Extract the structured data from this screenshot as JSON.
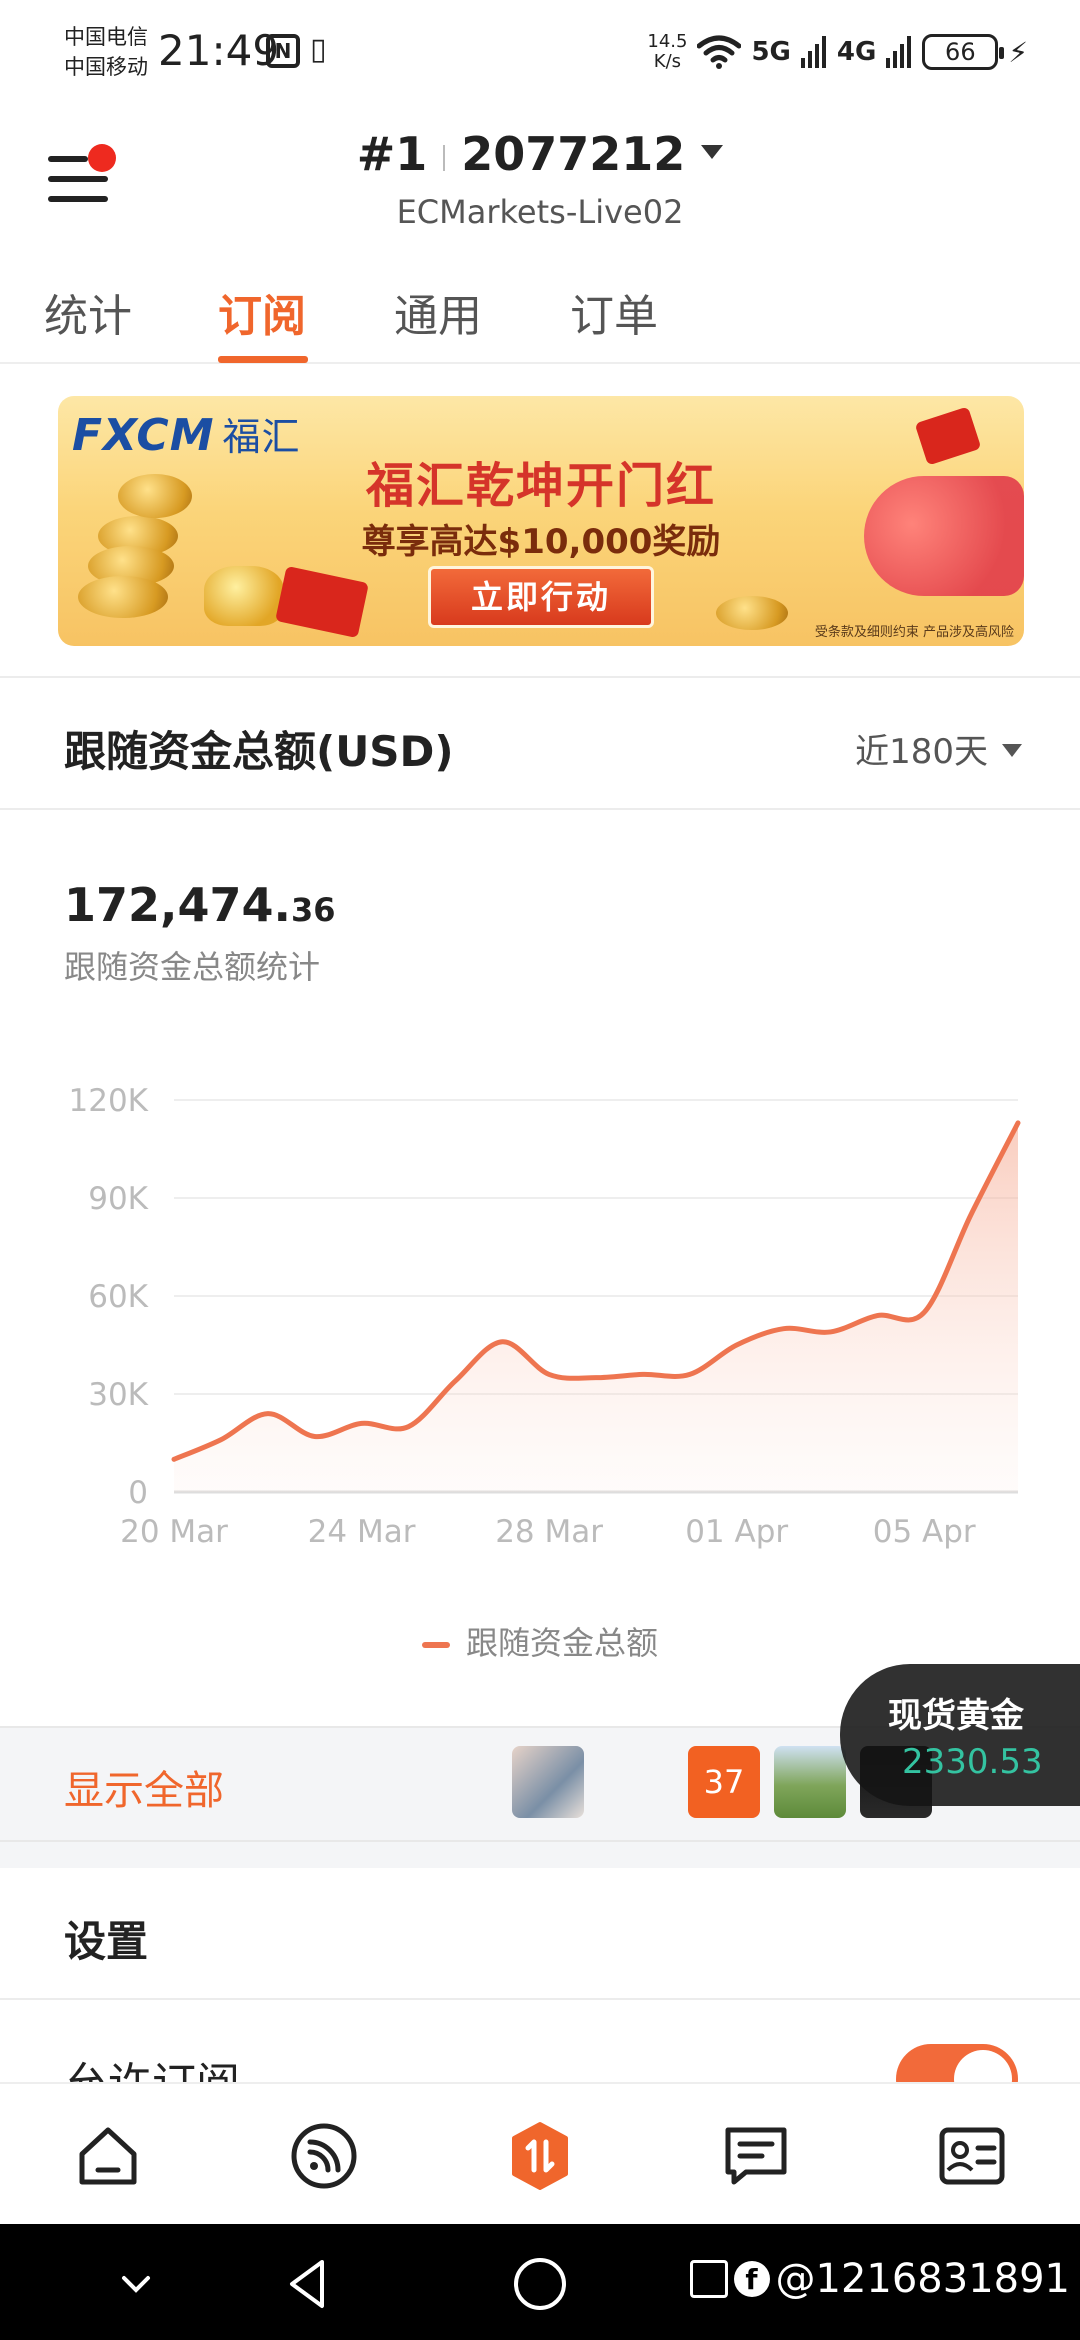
{
  "status_bar": {
    "carrier_1": "中国电信",
    "carrier_2": "中国移动",
    "time": "21:49",
    "nfc_icon": "N",
    "net_speed": "14.5",
    "net_speed_unit": "K/s",
    "signal_1": "5G",
    "signal_2": "4G",
    "battery": "66"
  },
  "header": {
    "account_rank": "#1",
    "account_id": "2077212",
    "server": "ECMarkets-Live02"
  },
  "tabs": [
    {
      "label": "统计",
      "active": false
    },
    {
      "label": "订阅",
      "active": true
    },
    {
      "label": "通用",
      "active": false
    },
    {
      "label": "订单",
      "active": false
    }
  ],
  "banner": {
    "brand": "FXCM",
    "brand_zh": "福汇",
    "title": "福汇乾坤开门红",
    "subtitle": "尊享高达$10,000奖励",
    "cta": "立即行动",
    "disclaimer": "受条款及细则约束 产品涉及高风险",
    "colors": {
      "accent": "#d5342a",
      "background": "#fbd57a"
    }
  },
  "card": {
    "title": "跟随资金总额(USD)",
    "range": "近180天",
    "total_int": "172,474.",
    "total_dec": "36",
    "total_label": "跟随资金总额统计",
    "legend": "跟随资金总额"
  },
  "chart_data": {
    "type": "area",
    "x": [
      "20 Mar",
      "21 Mar",
      "22 Mar",
      "23 Mar",
      "24 Mar",
      "25 Mar",
      "26 Mar",
      "27 Mar",
      "28 Mar",
      "29 Mar",
      "30 Mar",
      "31 Mar",
      "01 Apr",
      "02 Apr",
      "03 Apr",
      "04 Apr",
      "05 Apr",
      "06 Apr",
      "07 Apr"
    ],
    "series": [
      {
        "name": "跟随资金总额",
        "values": [
          10000,
          16000,
          24000,
          17000,
          21000,
          20000,
          34000,
          46000,
          36000,
          35000,
          36000,
          36000,
          45000,
          50000,
          49000,
          54000,
          55000,
          85000,
          113000
        ]
      }
    ],
    "x_tick_labels": [
      "20 Mar",
      "24 Mar",
      "28 Mar",
      "01 Apr",
      "05 Apr"
    ],
    "y_tick_labels": [
      "0",
      "30K",
      "60K",
      "90K",
      "120K"
    ],
    "ylim": [
      0,
      120000
    ],
    "grid": true,
    "color": "#ee7550"
  },
  "show_all": {
    "label": "显示全部",
    "badge_count": "37"
  },
  "ticker": {
    "name": "现货黄金",
    "price": "2330.53"
  },
  "settings": {
    "title": "设置",
    "allow_subscribe": "允许订阅",
    "allow_subscribe_on": true
  },
  "bottom_nav": [
    {
      "icon": "home-icon",
      "active": false
    },
    {
      "icon": "signal-feed-icon",
      "active": false
    },
    {
      "icon": "trade-icon",
      "active": true
    },
    {
      "icon": "messages-icon",
      "active": false
    },
    {
      "icon": "profile-card-icon",
      "active": false
    }
  ],
  "watermark": "@1216831891"
}
